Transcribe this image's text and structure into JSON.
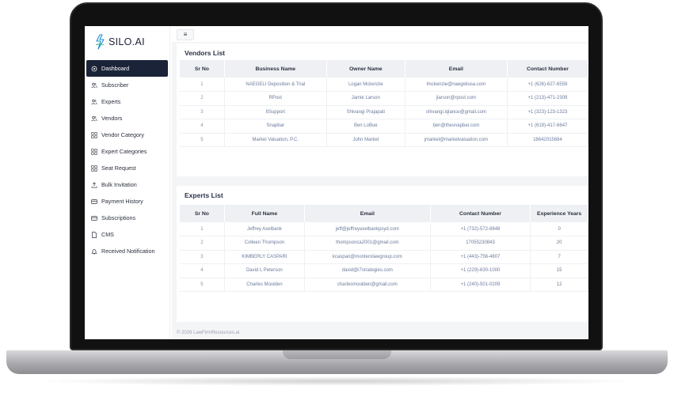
{
  "app": {
    "logo_text": "SILO.AI",
    "menu_icon": "hamburger-icon"
  },
  "sidebar": {
    "items": [
      {
        "label": "Dashboard",
        "icon": "dashboard-icon",
        "active": true
      },
      {
        "label": "Subscriber",
        "icon": "users-icon"
      },
      {
        "label": "Experts",
        "icon": "users-icon"
      },
      {
        "label": "Vendors",
        "icon": "users-icon"
      },
      {
        "label": "Vendor Category",
        "icon": "grid-icon"
      },
      {
        "label": "Expert Categories",
        "icon": "grid-icon"
      },
      {
        "label": "Seat Request",
        "icon": "grid-icon"
      },
      {
        "label": "Bulk Invitation",
        "icon": "upload-icon"
      },
      {
        "label": "Payment History",
        "icon": "card-icon"
      },
      {
        "label": "Subscriptions",
        "icon": "card-icon"
      },
      {
        "label": "CMS",
        "icon": "file-icon"
      },
      {
        "label": "Received Notification",
        "icon": "bell-icon"
      }
    ]
  },
  "vendors": {
    "title": "Vendors List",
    "columns": [
      "Sr No",
      "Business Name",
      "Owner Name",
      "Email",
      "Contact Number"
    ],
    "rows": [
      [
        "1",
        "NAEGELI Deposition & Trial",
        "Logan Mckenzie",
        "lmckenzie@naegeliusa.com",
        "+1 (626)-627-6559"
      ],
      [
        "2",
        "RPost",
        "Jamie Larson",
        "jlarson@rpost.com",
        "+1 (213)-471-2309"
      ],
      [
        "3",
        "ItSupport",
        "Shivangi Prajapati",
        "shivangi.iqlance@gmail.com",
        "+1 (323)-123-1323"
      ],
      [
        "4",
        "Snapbar",
        "Ben LoBue",
        "ben@thesnapbar.com",
        "+1 (619)-417-6647"
      ],
      [
        "5",
        "Markel Valuation, P.C.",
        "John Markel",
        "jmarkel@markelvaluation.com",
        "18642015684"
      ]
    ]
  },
  "experts": {
    "title": "Experts List",
    "columns": [
      "Sr No",
      "Full Name",
      "Email",
      "Contact Number",
      "Experience Years"
    ],
    "rows": [
      [
        "1",
        "Jeffrey Axelbank",
        "jeff@jeffreyaxelbankpsyd.com",
        "+1 (732)-572-8848",
        "0"
      ],
      [
        "2",
        "Colleen Thompson",
        "thompsonca2001@gmail.com",
        "17055230843",
        "20"
      ],
      [
        "3",
        "KIMBERLY CASPARI",
        "kcaspari@monterolawgroup.com",
        "+1 (443)-756-4807",
        "7"
      ],
      [
        "4",
        "David L Peterson",
        "david@i7strategies.com",
        "+1 (229)-630-1000",
        "15"
      ],
      [
        "5",
        "Charles Moulden",
        "charlesmoulden@gmail.com",
        "+1 (240)-501-0209",
        "12"
      ]
    ]
  },
  "footer": {
    "text": "© 2026 LawFirmResources.ai"
  },
  "colors": {
    "active_bg": "#1b2338",
    "link_text": "#6b7a9c",
    "header_bg": "#eef0f3"
  }
}
